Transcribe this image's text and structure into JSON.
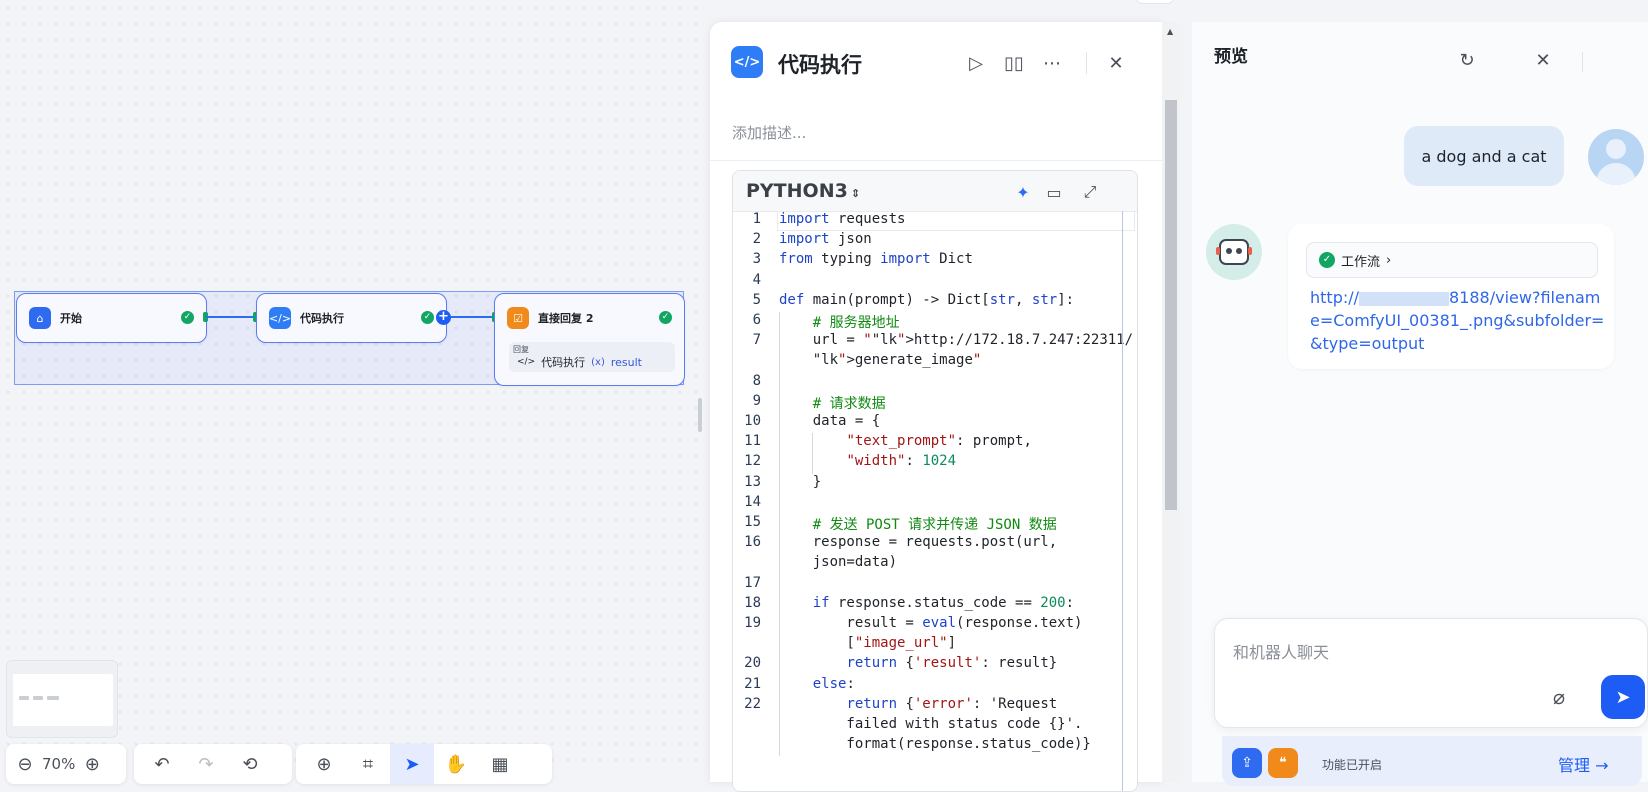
{
  "canvas": {
    "nodes": [
      {
        "title": "开始",
        "icon": "home-icon",
        "color": "#2f6bf0"
      },
      {
        "title": "代码执行",
        "icon": "code-icon",
        "color": "#2e7cf6"
      },
      {
        "title": "直接回复 2",
        "icon": "reply-icon",
        "color": "#f08a1a"
      }
    ],
    "reply_label": "回复",
    "reply_ref_node": "代码执行",
    "reply_ref_var": "result",
    "toolbar": {
      "zoom": "70%"
    }
  },
  "code_panel": {
    "title": "代码执行",
    "description_placeholder": "添加描述...",
    "language": "PYTHON3",
    "lines": [
      {
        "n": "1",
        "t": "import requests"
      },
      {
        "n": "2",
        "t": "import json"
      },
      {
        "n": "3",
        "t": "from typing import Dict"
      },
      {
        "n": "4",
        "t": ""
      },
      {
        "n": "5",
        "t": "def main(prompt) -> Dict[str, str]:"
      },
      {
        "n": "6",
        "t": "    # 服务器地址"
      },
      {
        "n": "7",
        "t": "    url = \"http://172.18.7.247:22311/"
      },
      {
        "n": "",
        "t": "    generate_image\""
      },
      {
        "n": "8",
        "t": ""
      },
      {
        "n": "9",
        "t": "    # 请求数据"
      },
      {
        "n": "10",
        "t": "    data = {"
      },
      {
        "n": "11",
        "t": "        \"text_prompt\": prompt,"
      },
      {
        "n": "12",
        "t": "        \"width\": 1024"
      },
      {
        "n": "13",
        "t": "    }"
      },
      {
        "n": "14",
        "t": ""
      },
      {
        "n": "15",
        "t": "    # 发送 POST 请求并传递 JSON 数据"
      },
      {
        "n": "16",
        "t": "    response = requests.post(url,"
      },
      {
        "n": "",
        "t": "    json=data)"
      },
      {
        "n": "17",
        "t": ""
      },
      {
        "n": "18",
        "t": "    if response.status_code == 200:"
      },
      {
        "n": "19",
        "t": "        result = eval(response.text)"
      },
      {
        "n": "",
        "t": "        [\"image_url\"]"
      },
      {
        "n": "20",
        "t": "        return {'result': result}"
      },
      {
        "n": "21",
        "t": "    else:"
      },
      {
        "n": "22",
        "t": "        return {'error': 'Request"
      },
      {
        "n": "",
        "t": "        failed with status code {}'."
      },
      {
        "n": "",
        "t": "        format(response.status_code)}"
      }
    ]
  },
  "preview": {
    "title": "预览",
    "user_message": "a dog and a cat",
    "workflow_label": "工作流",
    "bot_link_prefix": "http://",
    "bot_link_rest": "8188/view?filename=ComfyUI_00381_.png&subfolder=&type=output",
    "input_placeholder": "和机器人聊天",
    "feature_status": "功能已开启",
    "manage_label": "管理"
  }
}
